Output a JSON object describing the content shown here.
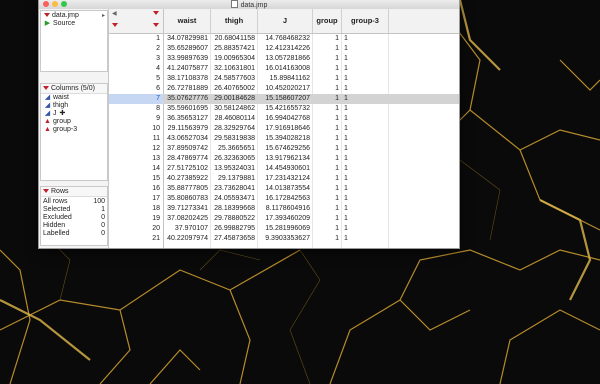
{
  "window": {
    "title": "data.jmp"
  },
  "table_panel": {
    "file": "data.jmp",
    "source": "Source"
  },
  "columns_panel": {
    "header": "Columns (5/0)",
    "items": [
      {
        "name": "waist",
        "type": "continuous"
      },
      {
        "name": "thigh",
        "type": "continuous"
      },
      {
        "name": "J",
        "type": "continuous"
      },
      {
        "name": "group",
        "type": "nominal"
      },
      {
        "name": "group-3",
        "type": "nominal"
      }
    ]
  },
  "rows_panel": {
    "header": "Rows",
    "items": [
      {
        "label": "All rows",
        "value": "100"
      },
      {
        "label": "Selected",
        "value": "1"
      },
      {
        "label": "Excluded",
        "value": "0"
      },
      {
        "label": "Hidden",
        "value": "0"
      },
      {
        "label": "Labelled",
        "value": "0"
      }
    ]
  },
  "grid": {
    "columns": [
      "waist",
      "thigh",
      "J",
      "group",
      "group-3"
    ],
    "selected_row": 7,
    "rows": [
      [
        "1",
        "34.07829981",
        "20.68041158",
        "14.768468232",
        "1",
        "1"
      ],
      [
        "2",
        "35.65289607",
        "25.88357421",
        "12.412314226",
        "1",
        "1"
      ],
      [
        "3",
        "33.99897639",
        "19.00965304",
        "13.057281866",
        "1",
        "1"
      ],
      [
        "4",
        "41.24075877",
        "32.10631801",
        "16.014163008",
        "1",
        "1"
      ],
      [
        "5",
        "38.17108378",
        "24.58577603",
        "15.89841162",
        "1",
        "1"
      ],
      [
        "6",
        "26.72781889",
        "26.40765002",
        "10.452020217",
        "1",
        "1"
      ],
      [
        "7",
        "35.07627776",
        "29.00184628",
        "15.158607207",
        "1",
        "1"
      ],
      [
        "8",
        "35.59601695",
        "30.58124862",
        "15.421655732",
        "1",
        "1"
      ],
      [
        "9",
        "36.35653127",
        "28.46080114",
        "16.994042768",
        "1",
        "1"
      ],
      [
        "10",
        "29.11563979",
        "28.32929764",
        "17.916918646",
        "1",
        "1"
      ],
      [
        "11",
        "43.06527034",
        "29.58319838",
        "15.394028218",
        "1",
        "1"
      ],
      [
        "12",
        "37.89509742",
        "25.3665651",
        "15.674629256",
        "1",
        "1"
      ],
      [
        "13",
        "28.47869774",
        "26.32363065",
        "13.917962134",
        "1",
        "1"
      ],
      [
        "14",
        "27.51725102",
        "13.95324031",
        "14.454930601",
        "1",
        "1"
      ],
      [
        "15",
        "40.27385922",
        "29.1379881",
        "17.231432124",
        "1",
        "1"
      ],
      [
        "16",
        "35.88777805",
        "23.73628041",
        "14.013873554",
        "1",
        "1"
      ],
      [
        "17",
        "35.80860783",
        "24.05593471",
        "16.172842563",
        "1",
        "1"
      ],
      [
        "18",
        "39.71273341",
        "28.18399668",
        "8.1178604916",
        "1",
        "1"
      ],
      [
        "19",
        "37.08202425",
        "29.78880522",
        "17.393460209",
        "1",
        "1"
      ],
      [
        "20",
        "37.970107",
        "26.99882795",
        "15.281996069",
        "1",
        "1"
      ],
      [
        "21",
        "40.22097974",
        "27.45873658",
        "9.3903353627",
        "1",
        "1"
      ]
    ]
  }
}
